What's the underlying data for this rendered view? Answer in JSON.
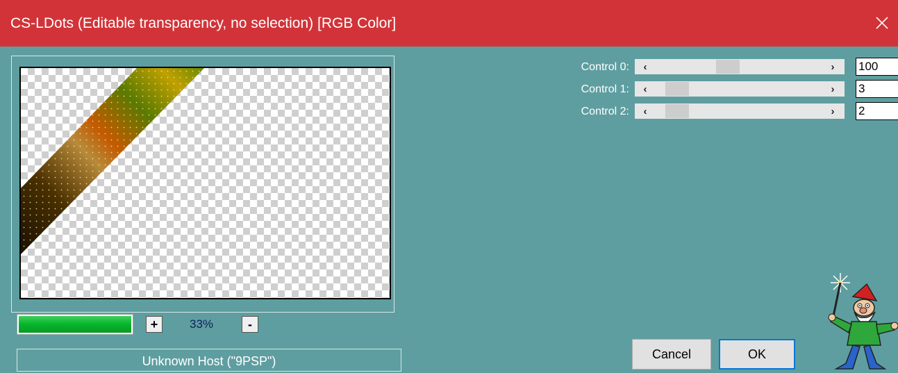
{
  "window": {
    "title": "CS-LDots (Editable transparency, no selection) [RGB Color]",
    "close_icon": "close-icon",
    "titlebar_color": "#d23338",
    "background_color": "#5f9ea0"
  },
  "preview": {
    "zoom_in_label": "+",
    "zoom_value": "33%",
    "zoom_out_label": "-",
    "progress_fraction": 1.0,
    "progress_color": "#06b52b"
  },
  "host": {
    "label": "Unknown Host (\"9PSP\")"
  },
  "controls": [
    {
      "label": "Control 0:",
      "value": "100",
      "slider_fraction": 0.42
    },
    {
      "label": "Control 1:",
      "value": "3",
      "slider_fraction": 0.05
    },
    {
      "label": "Control 2:",
      "value": "2",
      "slider_fraction": 0.05
    }
  ],
  "scroll_icons": {
    "left": "‹",
    "right": "›"
  },
  "buttons": {
    "cancel": "Cancel",
    "ok": "OK"
  },
  "mascot_icon": "gnome-wizard-icon"
}
